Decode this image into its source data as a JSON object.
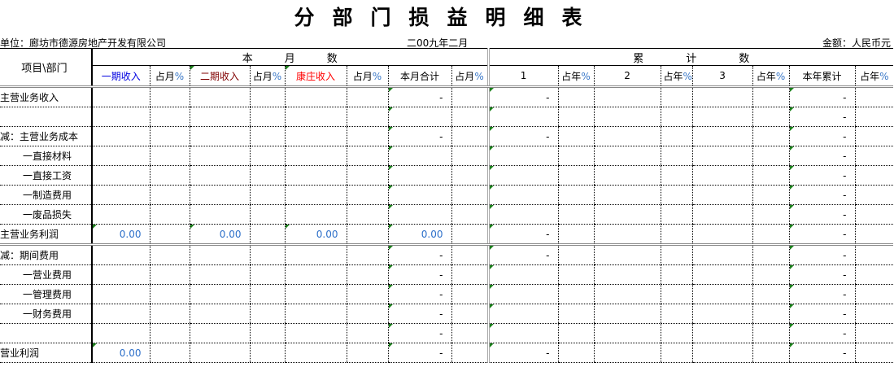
{
  "title": "分部门损益明细表",
  "unit": "单位：廊坊市德源房地产开发有限公司",
  "date": "二00九年二月",
  "amount_unit": "金额：人民币元",
  "header": {
    "row_label": "项目\\部门",
    "month_group": "本　　　月　　　数",
    "cumulative_group": "累　　　　计　　　　数",
    "columns": [
      {
        "label": "一期收入",
        "pct": ""
      },
      {
        "label": "占月",
        "pct": "%"
      },
      {
        "label": "二期收入",
        "pct": ""
      },
      {
        "label": "占月",
        "pct": "%"
      },
      {
        "label": "康庄收入",
        "pct": ""
      },
      {
        "label": "占月",
        "pct": "%"
      },
      {
        "label": "本月合计",
        "pct": ""
      },
      {
        "label": "占月",
        "pct": "%"
      },
      {
        "label": "1",
        "pct": ""
      },
      {
        "label": "占年",
        "pct": "%"
      },
      {
        "label": "2",
        "pct": ""
      },
      {
        "label": "占年",
        "pct": "%"
      },
      {
        "label": "3",
        "pct": ""
      },
      {
        "label": "占年",
        "pct": "%"
      },
      {
        "label": "本年累计",
        "pct": ""
      },
      {
        "label": "占年",
        "pct": "%"
      }
    ]
  },
  "rows": [
    {
      "label": "主营业务收入",
      "indent": false,
      "cells": [
        "",
        "",
        "",
        "",
        "",
        "",
        "-",
        "",
        "-",
        "",
        "",
        "",
        "",
        "",
        "-",
        ""
      ]
    },
    {
      "label": "",
      "indent": false,
      "cells": [
        "",
        "",
        "",
        "",
        "",
        "",
        "",
        "",
        "",
        "",
        "",
        "",
        "",
        "",
        "-",
        ""
      ]
    },
    {
      "label": "减：主营业务成本",
      "indent": false,
      "cells": [
        "",
        "",
        "",
        "",
        "",
        "",
        "-",
        "",
        "-",
        "",
        "",
        "",
        "",
        "",
        "-",
        ""
      ]
    },
    {
      "label": "一直接材料",
      "indent": true,
      "cells": [
        "",
        "",
        "",
        "",
        "",
        "",
        "",
        "",
        "",
        "",
        "",
        "",
        "",
        "",
        "-",
        ""
      ]
    },
    {
      "label": "一直接工资",
      "indent": true,
      "cells": [
        "",
        "",
        "",
        "",
        "",
        "",
        "",
        "",
        "",
        "",
        "",
        "",
        "",
        "",
        "-",
        ""
      ]
    },
    {
      "label": "一制造费用",
      "indent": true,
      "cells": [
        "",
        "",
        "",
        "",
        "",
        "",
        "",
        "",
        "",
        "",
        "",
        "",
        "",
        "",
        "-",
        ""
      ]
    },
    {
      "label": "一废品损失",
      "indent": true,
      "cells": [
        "",
        "",
        "",
        "",
        "",
        "",
        "",
        "",
        "",
        "",
        "",
        "",
        "",
        "",
        "-",
        ""
      ]
    },
    {
      "label": "主营业务利润",
      "indent": false,
      "cells": [
        "0.00",
        "",
        "0.00",
        "",
        "0.00",
        "",
        "0.00",
        "",
        "-",
        "",
        "",
        "",
        "",
        "",
        "-",
        ""
      ]
    },
    {
      "label": "减：期间费用",
      "indent": false,
      "cells": [
        "",
        "",
        "",
        "",
        "",
        "",
        "-",
        "",
        "-",
        "",
        "",
        "",
        "",
        "",
        "-",
        ""
      ]
    },
    {
      "label": "一营业费用",
      "indent": true,
      "cells": [
        "",
        "",
        "",
        "",
        "",
        "",
        "-",
        "",
        "",
        "",
        "",
        "",
        "",
        "",
        "-",
        ""
      ]
    },
    {
      "label": "一管理费用",
      "indent": true,
      "cells": [
        "",
        "",
        "",
        "",
        "",
        "",
        "-",
        "",
        "",
        "",
        "",
        "",
        "",
        "",
        "-",
        ""
      ]
    },
    {
      "label": "一财务费用",
      "indent": true,
      "cells": [
        "",
        "",
        "",
        "",
        "",
        "",
        "-",
        "",
        "",
        "",
        "",
        "",
        "",
        "",
        "-",
        ""
      ]
    },
    {
      "label": "",
      "indent": false,
      "cells": [
        "",
        "",
        "",
        "",
        "",
        "",
        "-",
        "",
        "",
        "",
        "",
        "",
        "",
        "",
        "-",
        ""
      ]
    },
    {
      "label": "营业利润",
      "indent": false,
      "cells": [
        "0.00",
        "",
        "",
        "",
        "",
        "",
        "-",
        "",
        "-",
        "",
        "",
        "",
        "",
        "",
        "-",
        ""
      ]
    }
  ]
}
